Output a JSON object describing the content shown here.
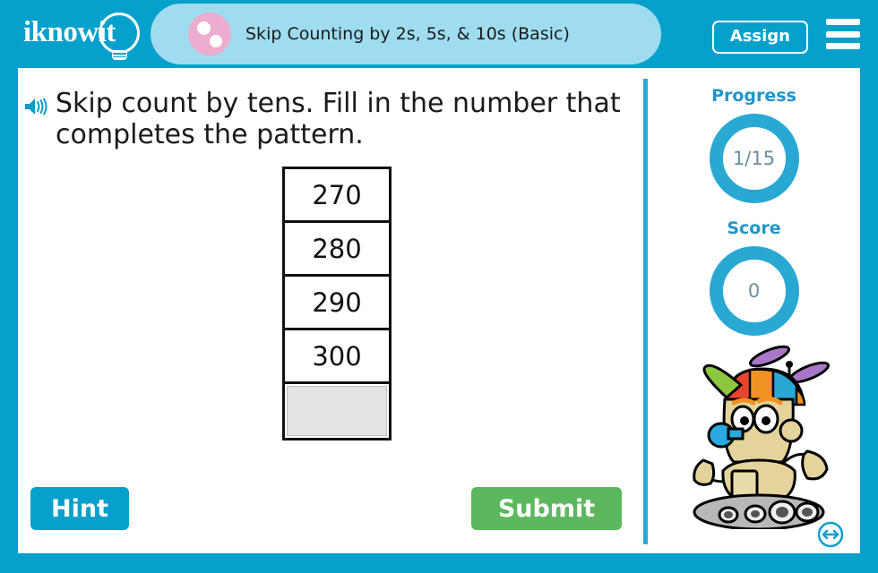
{
  "header": {
    "logo_text": "iknowit",
    "logo_icon": "lightbulb-icon",
    "lesson_title": "Skip Counting by 2s, 5s, & 10s (Basic)",
    "assign_label": "Assign",
    "menu_icon": "hamburger-menu-icon",
    "brand_color": "#06a0cc",
    "title_panel_color": "#9fdcef",
    "title_dot_color": "#edadce"
  },
  "question": {
    "audio_icon": "speaker-icon",
    "text": "Skip count by tens. Fill in the number that completes the pattern."
  },
  "pattern": {
    "values": [
      "270",
      "280",
      "290",
      "300"
    ],
    "answer_value": "",
    "answer_placeholder": ""
  },
  "actions": {
    "hint_label": "Hint",
    "hint_color": "#06a0cc",
    "submit_label": "Submit",
    "submit_color": "#5cb85c"
  },
  "sidebar": {
    "progress_label": "Progress",
    "progress_value": "1/15",
    "score_label": "Score",
    "score_value": "0",
    "ring_color": "#2aa8d4",
    "mascot_icon": "robot-mascot-image",
    "resize_icon": "resize-horizontal-icon"
  }
}
